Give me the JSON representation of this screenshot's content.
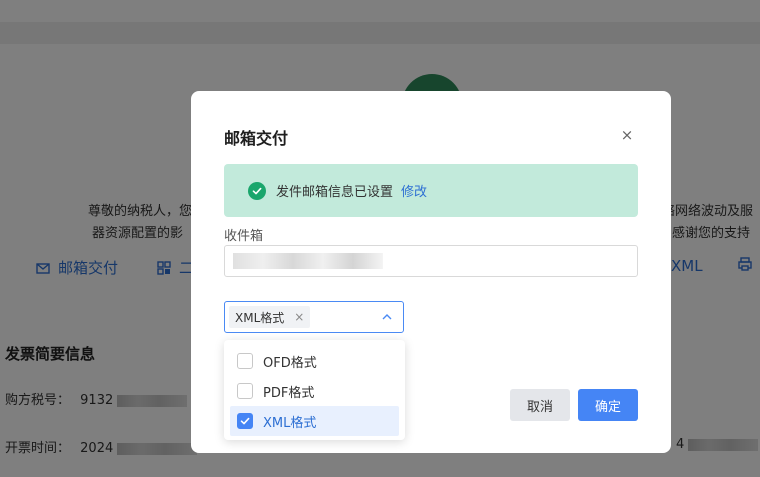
{
  "background": {
    "notice_line1_left": "尊敬的纳税人，您",
    "notice_line1_right": "络网络波动及服",
    "notice_line2_left": "器资源配置的影",
    "notice_line2_right": "感谢您的支持",
    "action_email": "邮箱交付",
    "action_qr": "二",
    "action_xml": "XML",
    "section_title": "发票简要信息",
    "buyer_tax_label": "购方税号：",
    "buyer_tax_value": "9132",
    "issue_time_label": "开票时间：",
    "issue_time_value": "2024",
    "issue_time_tail": "4"
  },
  "dialog": {
    "title": "邮箱交付",
    "close": "×",
    "alert_text": "发件邮箱信息已设置",
    "alert_link": "修改",
    "recipient_label": "收件箱",
    "format_tag": "XML格式",
    "tag_close": "×",
    "cancel_label": "取消",
    "ok_label": "确定"
  },
  "dropdown": {
    "options": [
      {
        "label": "OFD格式",
        "checked": false
      },
      {
        "label": "PDF格式",
        "checked": false
      },
      {
        "label": "XML格式",
        "checked": true
      }
    ]
  },
  "colors": {
    "primary": "#4585f5",
    "success": "#1aa66c",
    "alert_bg": "#c2eadb",
    "link": "#2d6fd3"
  }
}
